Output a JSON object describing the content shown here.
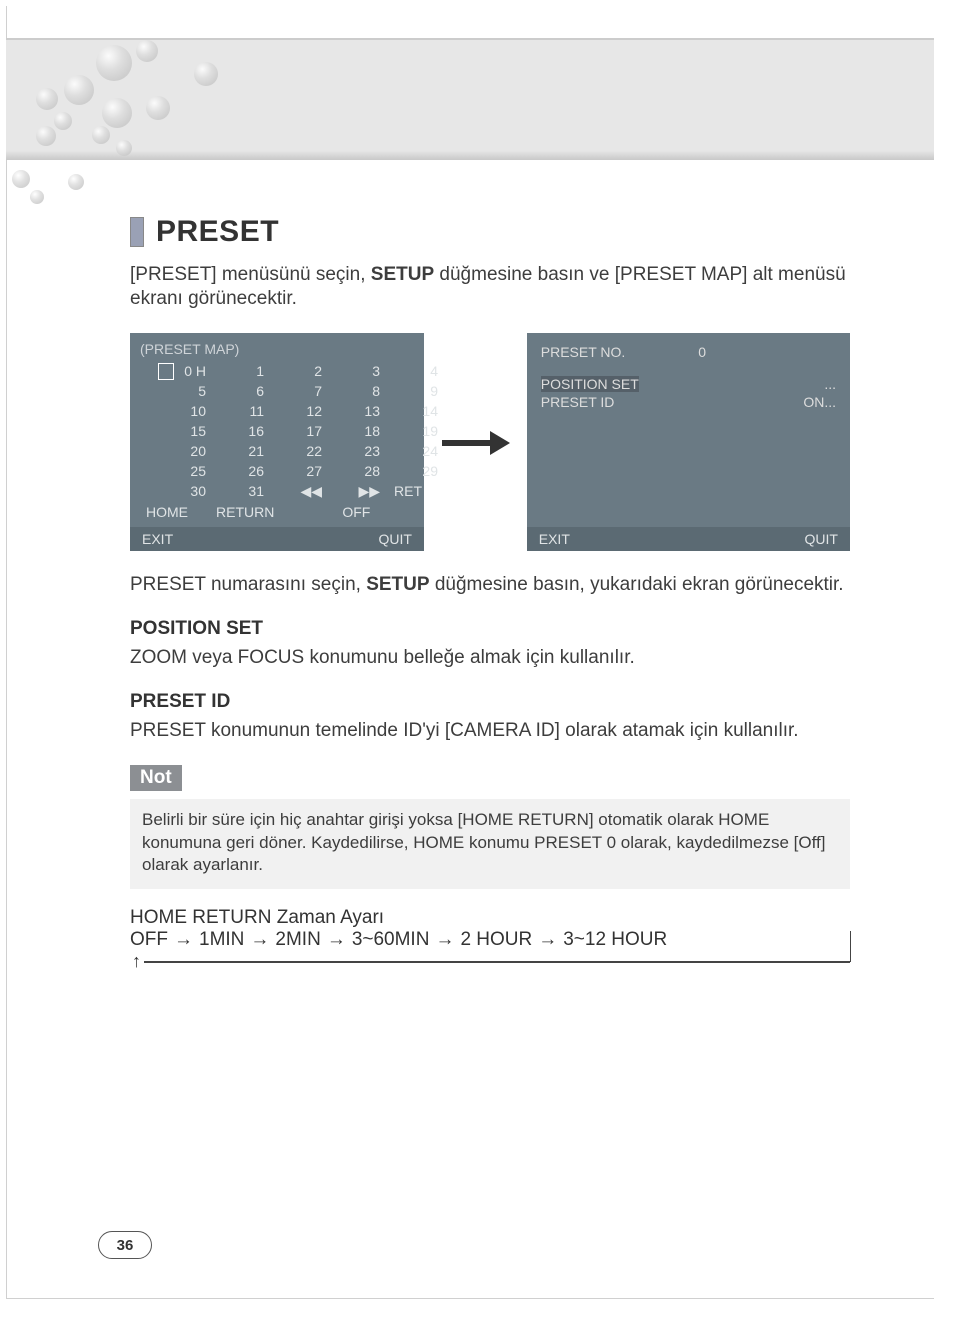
{
  "heading": "PRESET",
  "intro": {
    "pre": "[PRESET] menüsünü seçin, ",
    "bold": "SETUP",
    "post": " düğmesine basın ve [PRESET MAP] alt menüsü ekranı görünecektir."
  },
  "panel_left": {
    "title": "(PRESET MAP)",
    "grid": [
      "0  H",
      "1",
      "2",
      "3",
      "4",
      "5",
      "6",
      "7",
      "8",
      "9",
      "10",
      "11",
      "12",
      "13",
      "14",
      "15",
      "16",
      "17",
      "18",
      "19",
      "20",
      "21",
      "22",
      "23",
      "24",
      "25",
      "26",
      "27",
      "28",
      "29",
      "30",
      "31",
      "◀◀",
      "▶▶",
      "RET"
    ],
    "bottom_row": {
      "left": "HOME",
      "mid": "RETURN",
      "right": "OFF"
    },
    "footer_left": "EXIT",
    "footer_right": "QUIT"
  },
  "panel_right": {
    "line1_label": "PRESET NO.",
    "line1_value": "0",
    "line2_label": "POSITION SET",
    "line2_value": "...",
    "line3_label": "PRESET ID",
    "line3_value": "ON...",
    "footer_left": "EXIT",
    "footer_right": "QUIT"
  },
  "after_panels": {
    "pre": "PRESET numarasını seçin, ",
    "bold": "SETUP",
    "post": " düğmesine basın, yukarıdaki ekran görünecektir."
  },
  "position_set": {
    "title": "POSITION SET",
    "body": "ZOOM veya FOCUS konumunu belleğe almak için kullanılır."
  },
  "preset_id": {
    "title": "PRESET ID",
    "body": "PRESET konumunun temelinde ID'yi [CAMERA ID] olarak atamak için kullanılır."
  },
  "note": {
    "tag": "Not",
    "body": "Belirli bir süre için hiç anahtar girişi yoksa [HOME RETURN] otomatik olarak HOME konumuna geri döner. Kaydedilirse, HOME konumu PRESET 0 olarak, kaydedilmezse [Off] olarak ayarlanır."
  },
  "home_return": {
    "title": "HOME RETURN Zaman Ayarı",
    "seq": [
      "OFF",
      "→",
      "1MIN",
      "→",
      "2MIN",
      "→",
      "3~60MIN",
      "→",
      "2 HOUR",
      "→",
      "3~12 HOUR"
    ]
  },
  "page_number": "36"
}
